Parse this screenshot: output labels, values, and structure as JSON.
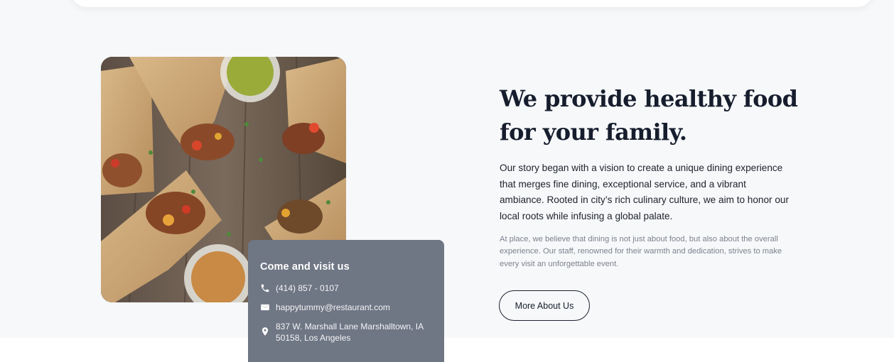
{
  "visit_card": {
    "title": "Come and visit us",
    "phone": "(414) 857 - 0107",
    "email": "happytummy@restaurant.com",
    "address": "837 W. Marshall Lane Marshalltown, IA 50158, Los Angeles",
    "icons": [
      "phone-icon",
      "mail-icon",
      "location-pin-icon"
    ]
  },
  "about": {
    "headline": "We provide healthy food for your family.",
    "intro": "Our story began with a vision to create a unique dining experience that merges fine dining, exceptional service, and a vibrant ambiance. Rooted in city’s rich culinary culture, we aim to honor our local roots while infusing a global palate.",
    "secondary": "At place, we believe that dining is not just about food, but also about the overall experience. Our staff, renowned for their warmth and dedication, strives to make every visit an unforgettable event.",
    "button_label": "More About Us"
  },
  "colors": {
    "background": "#f6f8fa",
    "card": "#6f7684",
    "heading": "#161d2d"
  }
}
